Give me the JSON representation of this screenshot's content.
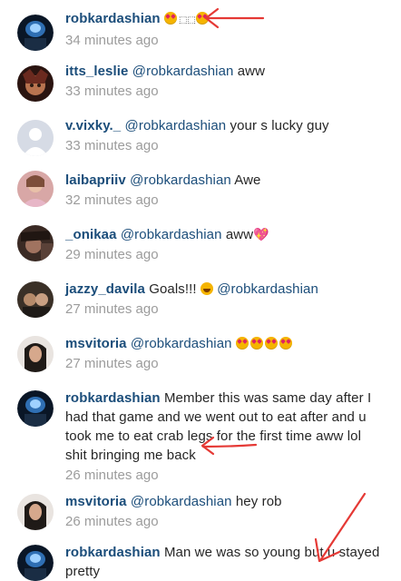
{
  "comments": [
    {
      "user": "robkardashian",
      "mention": "",
      "text": "",
      "emoji": "😍😍",
      "time": "34 minutes ago"
    },
    {
      "user": "itts_leslie",
      "mention": "@robkardashian",
      "text": " aww",
      "time": "33 minutes ago"
    },
    {
      "user": "v.vixky._",
      "mention": "@robkardashian",
      "text": " your s lucky guy",
      "time": "33 minutes ago"
    },
    {
      "user": "laibapriiv",
      "mention": "@robkardashian",
      "text": " Awe",
      "time": "32 minutes ago"
    },
    {
      "user": "_onikaa",
      "mention": "@robkardashian",
      "text": " aww",
      "emoji": "💖",
      "time": "29 minutes ago"
    },
    {
      "user": "jazzy_davila",
      "text_before": " Goals!!! ",
      "emoji": "😂",
      "mention": "@robkardashian",
      "time": "27 minutes ago"
    },
    {
      "user": "msvitoria",
      "mention": "@robkardashian",
      "emoji": "😍😍😍😍",
      "time": "27 minutes ago"
    },
    {
      "user": "robkardashian",
      "text_line1": " Member this was same day after I",
      "text_line2": "had that game and we went out to eat after and u",
      "text_line3": "took me to eat crab legs for the first time aww lol",
      "text_line4": "shit bringing me back",
      "time": "26 minutes ago"
    },
    {
      "user": "msvitoria",
      "mention": "@robkardashian",
      "text": " hey rob",
      "time": "26 minutes ago"
    },
    {
      "user": "robkardashian",
      "text_line1": " Man we was so young but u stayed",
      "text_line2": "pretty"
    }
  ],
  "colors": {
    "username": "#1b4d7a",
    "text": "#262626",
    "timestamp": "#9c9c9c",
    "arrow": "#e53935"
  }
}
